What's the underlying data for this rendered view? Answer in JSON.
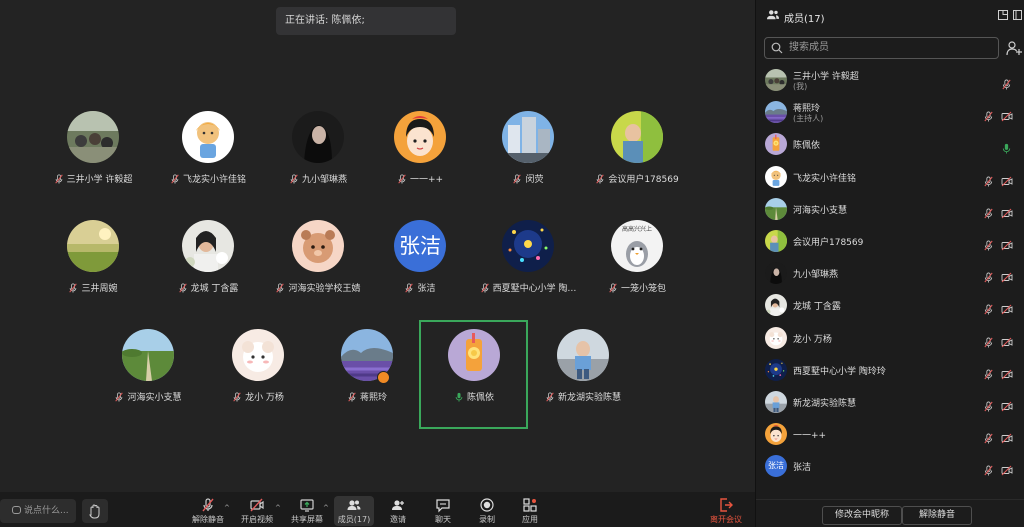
{
  "speaking_banner": "正在讲话: 陈佩依;",
  "tiles": [
    {
      "name": "三井小学 许毅超",
      "avatar": "photo-classroom",
      "muted": true
    },
    {
      "name": "飞龙实小许佳铭",
      "avatar": "cartoon-girl",
      "muted": true
    },
    {
      "name": "九小邹琳燕",
      "avatar": "photo-dark-hair",
      "muted": true
    },
    {
      "name": "一一++",
      "avatar": "cartoon-snow-white",
      "muted": true
    },
    {
      "name": "闵荧",
      "avatar": "photo-building",
      "muted": true
    },
    {
      "name": "会议用户178569",
      "avatar": "photo-child-green",
      "muted": true
    },
    {
      "name": "三井周婉",
      "avatar": "photo-field",
      "muted": true
    },
    {
      "name": "龙城 丁含露",
      "avatar": "photo-woman-flowers",
      "muted": true
    },
    {
      "name": "河海实验学校王婧",
      "avatar": "cartoon-bear",
      "muted": true
    },
    {
      "name": "张洁",
      "avatar_text": "张洁",
      "muted": true
    },
    {
      "name": "西夏墅中心小学 陶…",
      "avatar": "photo-night-lights",
      "muted": true
    },
    {
      "name": "一笼小笼包",
      "avatar": "cartoon-penguin",
      "avatar_caption": "高高兴兴上",
      "muted": true
    },
    {
      "name": "河海实小支慧",
      "avatar": "photo-path",
      "muted": true
    },
    {
      "name": "龙小 万杨",
      "avatar": "cartoon-lamb",
      "muted": true
    },
    {
      "name": "蒋熙玲",
      "avatar": "photo-lavender",
      "muted": true,
      "host": true
    },
    {
      "name": "陈佩依",
      "avatar": "drink-orange",
      "muted": false,
      "speaking": true
    },
    {
      "name": "新龙湖实验陈慧",
      "avatar": "photo-kid-outdoor",
      "muted": true
    }
  ],
  "toolbar": {
    "chat_placeholder": "说点什么...",
    "unmute": "解除静音",
    "start_video": "开启视频",
    "share_screen": "共享屏幕",
    "members": "成员(17)",
    "invite": "邀请",
    "chat": "聊天",
    "record": "录制",
    "apps": "应用",
    "leave": "离开会议"
  },
  "panel": {
    "title": "成员(17)",
    "search_placeholder": "搜索成员",
    "members": [
      {
        "name": "三井小学 许毅超",
        "sub": "(我)",
        "avatar": "photo-classroom",
        "mic": "muted",
        "cam": false
      },
      {
        "name": "蒋熙玲",
        "sub": "(主持人)",
        "avatar": "photo-lavender",
        "mic": "muted",
        "cam": "off"
      },
      {
        "name": "陈佩依",
        "avatar": "drink-orange",
        "mic": "on",
        "cam": false
      },
      {
        "name": "飞龙实小许佳铭",
        "avatar": "cartoon-girl",
        "mic": "muted",
        "cam": "off"
      },
      {
        "name": "河海实小支慧",
        "avatar": "photo-path",
        "mic": "muted",
        "cam": "off"
      },
      {
        "name": "会议用户178569",
        "avatar": "photo-child-green",
        "mic": "muted",
        "cam": "off"
      },
      {
        "name": "九小邹琳燕",
        "avatar": "photo-dark-hair",
        "mic": "muted",
        "cam": "off"
      },
      {
        "name": "龙城 丁含露",
        "avatar": "photo-woman-flowers",
        "mic": "muted",
        "cam": "off"
      },
      {
        "name": "龙小 万杨",
        "avatar": "cartoon-lamb",
        "mic": "muted",
        "cam": "off"
      },
      {
        "name": "西夏墅中心小学 陶玲玲",
        "avatar": "photo-night-lights",
        "mic": "muted",
        "cam": "off"
      },
      {
        "name": "新龙湖实验陈慧",
        "avatar": "photo-kid-outdoor",
        "mic": "muted",
        "cam": "off"
      },
      {
        "name": "一一++",
        "avatar": "cartoon-snow-white",
        "mic": "muted",
        "cam": "off"
      },
      {
        "name": "张洁",
        "avatar_text": "张洁",
        "mic": "muted",
        "cam": "off"
      }
    ],
    "rename_button": "修改会中昵称",
    "unmute_button": "解除静音"
  },
  "colors": {
    "stage_bg": "#232323",
    "panel_bg": "#1c1c1c",
    "speaking_frame": "#3aa85b",
    "mic_muted": "#e05b5b",
    "mic_on": "#3aa85b",
    "leave": "#e8553f",
    "avatar_text_bg": "#3a6fd8"
  }
}
